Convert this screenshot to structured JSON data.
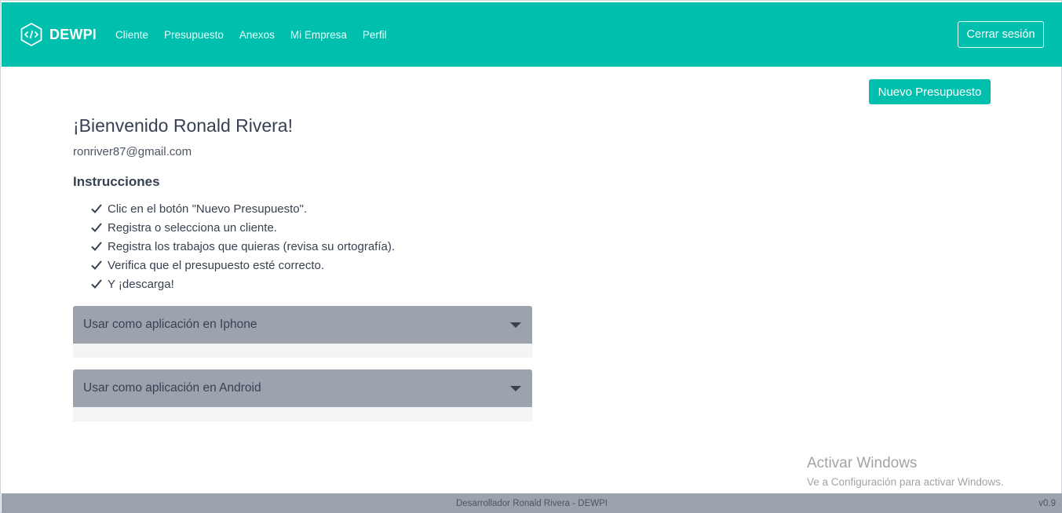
{
  "navbar": {
    "brand": "DEWPI",
    "links": [
      "Cliente",
      "Presupuesto",
      "Anexos",
      "Mi Empresa",
      "Perfil"
    ],
    "logout_label": "Cerrar sesión"
  },
  "actions": {
    "new_quote_label": "Nuevo Presupuesto"
  },
  "main": {
    "welcome": "¡Bienvenido Ronald Rivera!",
    "email": "ronriver87@gmail.com",
    "instructions_title": "Instrucciones",
    "steps": [
      "Clic en el botón \"Nuevo Presupuesto\".",
      "Registra o selecciona un cliente.",
      "Registra los trabajos que quieras (revisa su ortografía).",
      "Verifica que el presupuesto esté correcto.",
      "Y ¡descarga!"
    ],
    "accordions": [
      {
        "label": "Usar como aplicación en Iphone"
      },
      {
        "label": "Usar como aplicación en Android"
      }
    ]
  },
  "watermark": {
    "title": "Activar Windows",
    "subtitle": "Ve a Configuración para activar Windows."
  },
  "footer": {
    "text": "Desarrollador Ronald Rivera - DEWPI",
    "version": "v0.9"
  },
  "colors": {
    "primary": "#00bfad",
    "accordion": "#9ca3af",
    "footer": "#9ca3af"
  }
}
